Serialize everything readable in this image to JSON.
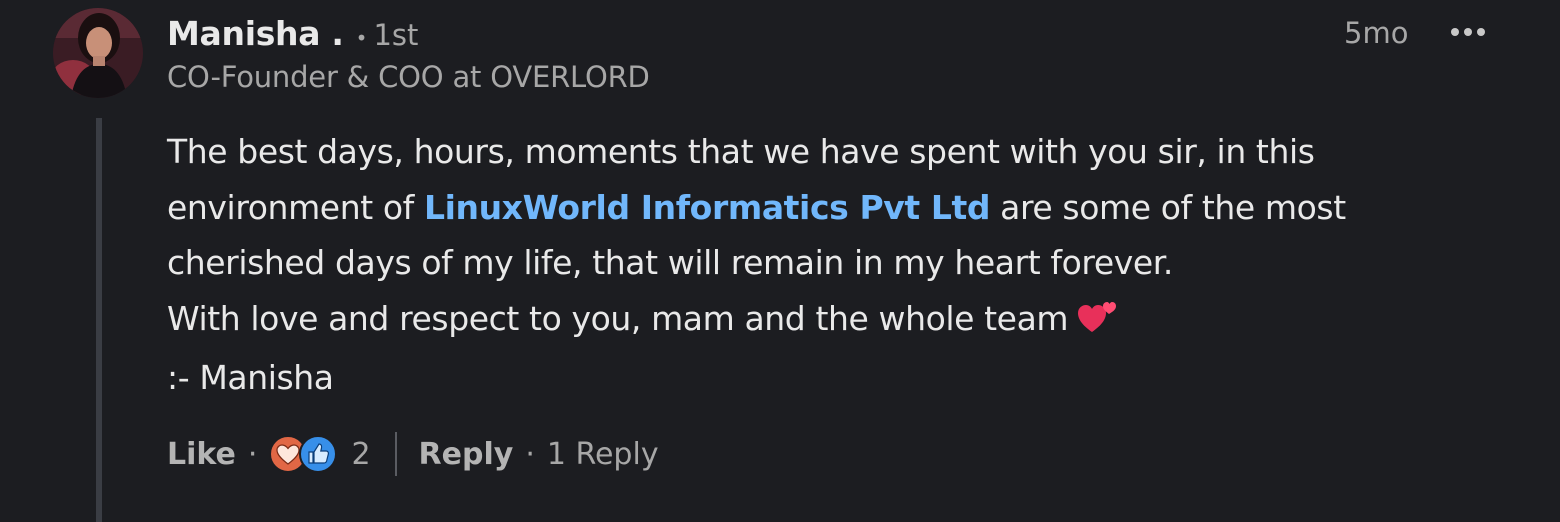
{
  "comment": {
    "author": {
      "name": "Manisha .",
      "degree_dot": "•",
      "degree": "1st",
      "headline": "CO-Founder & COO at OVERLORD"
    },
    "timestamp": "5mo",
    "more_icon": "ellipsis-icon",
    "body": {
      "line1": "The best days, hours, moments that we have spent with you sir, in this",
      "line2_before": "environment of ",
      "mention": "LinuxWorld Informatics Pvt Ltd",
      "line2_after": " are some of the most",
      "line3": "cherished days of my life, that will remain in my heart forever.",
      "line4": "With love and respect to you, mam and the whole team",
      "line4_emoji": "two-hearts-emoji",
      "line5": ":- Manisha"
    },
    "actions": {
      "like_label": "Like",
      "separator": "·",
      "reaction_icons": [
        "love-reaction-icon",
        "like-reaction-icon"
      ],
      "reaction_count": "2",
      "reply_label": "Reply",
      "reply_count": "1 Reply"
    },
    "colors": {
      "background": "#1c1d21",
      "text": "#e9e9e9",
      "muted": "#a7a7a7",
      "mention": "#71b7fb",
      "love_reaction": "#e16745",
      "like_reaction": "#378fe9",
      "heart_emoji": "#e8305a"
    }
  }
}
